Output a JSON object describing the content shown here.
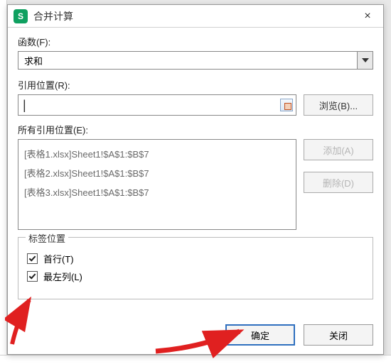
{
  "titlebar": {
    "app_icon_letter": "S",
    "title": "合并计算",
    "close_glyph": "×"
  },
  "labels": {
    "function": "函数(F):",
    "reference": "引用位置(R):",
    "all_refs": "所有引用位置(E):",
    "label_position": "标签位置"
  },
  "function_select": {
    "value": "求和"
  },
  "reference_input": {
    "value": "",
    "placeholder": ""
  },
  "buttons": {
    "browse": "浏览(B)...",
    "add": "添加(A)",
    "delete": "删除(D)",
    "ok": "确定",
    "close": "关闭"
  },
  "ref_list": [
    "[表格1.xlsx]Sheet1!$A$1:$B$7",
    "[表格2.xlsx]Sheet1!$A$1:$B$7",
    "[表格3.xlsx]Sheet1!$A$1:$B$7"
  ],
  "checkboxes": {
    "top_row": {
      "label": "首行(T)",
      "checked": true
    },
    "left_col": {
      "label": "最左列(L)",
      "checked": true
    }
  },
  "icons": {
    "range_picker": "range-picker-icon",
    "dropdown_caret": "caret-down-icon"
  },
  "colors": {
    "accent_green": "#0fa060",
    "primary_blue": "#2e6fbf",
    "arrow_red": "#e02020"
  }
}
